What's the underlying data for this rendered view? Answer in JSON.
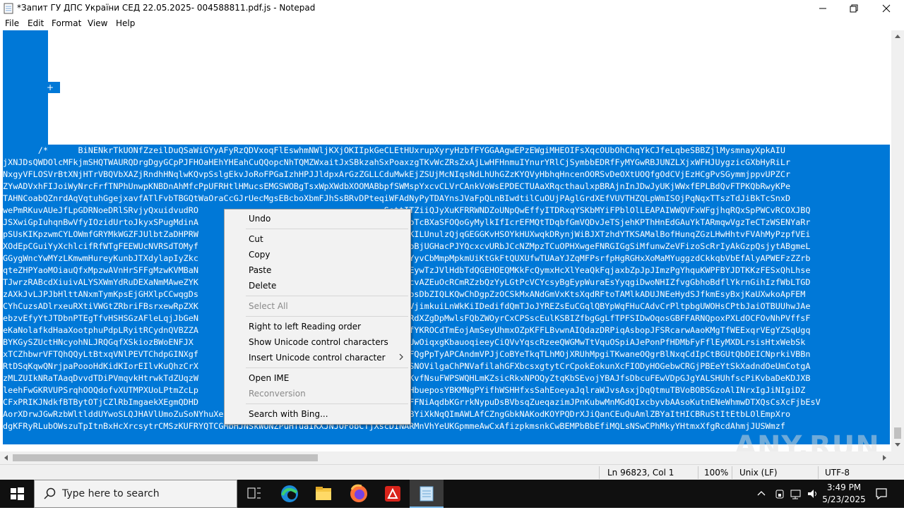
{
  "window": {
    "title": "*Запит ГУ ДПС України СЕД 22.05.2025- 004588811.pdf.js - Notepad",
    "controls": [
      "minimize",
      "maximize",
      "close"
    ]
  },
  "menu": {
    "items": [
      "File",
      "Edit",
      "Format",
      "View",
      "Help"
    ]
  },
  "editor": {
    "plus_glyph": "+",
    "lines": [
      "       /*      BiNENkrTkUONfZzeilDuQSaWiGYyAFyRzQDVxoqFlEswhmNWljKXjOKIIpkGeCLEtHUxrupXyryHzbfFYGGAAgwEPzEWgiMHEOIFsXqcOUbOhChqYkCJfeLqbeSBBZjlMysmnayXpkAIU",
      "jXNJDsQWDOlcMFkjmSHQTWAURQDrgDgyGCpPJFHOaHEhYHEahCuQQopcNhTQMZWxaitJxSBkzahSxPoaxzgTKvWcZRsZxAjLwHFHnmuIYnurYRlCjSymbbEDRfFyMYGwRBJUNZLXjxWFHJUygzicGXbHyRiLr",
      "NxgyVFLOSVrBtXNjHTrVBQVbXAZjRndhHNqlwKQvpSslgEkvJoRoFPGaIzhHPJJldpxArGzZGLLCduMwkEjZSUjMcNIqsNdLhUhGZzKYQVyHbhqHncenOORSvDeOXtUOQfgOdCVjEzHCgPvSGymmjppvUPZCr",
      "ZYwADVxhFIJoiWyNrcFrfTNPhUnwpKNBDnAhMfcPpUFRHtlHMucsEMGSWOBgTsxWpXWdbXOOMABbpfSWMspYxcvCLVrCAnkVoWsEPDECTUAaXRqcthaulxpBRAjnInJDwJyUKjWWxfEPLBdQvFTPKQbRwyKPe",
      "TAHNCoabQZnrdAqVqtuhGgejxavfATlFvbTBGQtWaOraCcGJrUecMgsEBcboXbmFJhSsBRvDPteqiWFAdNyPyTDAYnsJVaFpQLnBIwdtilCuOUjPAglGrdXEfVUVTHZQLpWmISOjPqNqxTTszTdJiBkTcSnxD",
      "wePmRKuvAUeJfLpGDRNoeDRlSRvjyQxuidvudRO                                     SsttITZiiQJyXuKFRRWNDZoUNpQwEffyITDRxqYSKbMYiFPblOlLEAPAIWWQVFxWFgjhqRQxSpPWCvRCOXJBQ",
      "JSXwiGpIuhqnBwVfyIOzidUrtoJkyxSPugMdinA                                     vvmOWbTcBXaSFOQoGyMylkIfIcrEFMQtTDqbfGmVQDvJeTSjehKPThHnEdGAuYkTARmqwVgzTeCTzWSENYaRr",
      "pSUsKIKpzwmCYLOWmfGRYMkWGZFJUlbtZaDHPRW                                     CiTBgKILUnulzQjqGEGGKvHSOYkHUXwqkDRynjWiBJXTzhdYTKSAMalBofHunqZGzLHwHhtvFVAhMyPzpfVEi",
      "XOdEpCGuiYyXchlcifRfWTgFEEWUcNVRSdTOMyf                                     OIqUvbBjUGHacPJYQcxcvURbJCcNZMpzTCuOPHXwgeFNRGIGgSiMfunwZeVFizoScRrIyAkGzpQsjytABgmeL",
      "GGygWncYwMYzLKmwmHureyKunbJTXdylapIyZkc                                     eUCURYyvCbMmpMpkmUiKtGkFtQUXUfwTUAaYJZqMFPsrfpHgRGHxXoMaMYuggzdCkkqbVbEfAlyAPWEFzZZrb",
      "qteZHPYaoMOiauQfxMpzwAVnHrSFFgMzwKVMBaN                                     zTDBtEywTzJVlHdbTdQGEHOEQMKkFcQymxHcXlYeaQkFqjaxbZpJpJImzPgYhquKWPFBYJDTKKzFESxQhLhse",
      "TJwrzRABcdXiuivALYSXWmYdRuDEXaNmMAweZYK                                     jiMUFcvAZEuOcRCmRZzbQzYyLGtPcVCYcsyBgEypWuraEsYyqgiDwoNHIZfvgGbhoBdflYkrnGihIzfWbLTGD",
      "zAXkJvLJPJbHlttANxmTymKpsEjGHXlpCCwqgDs                                     DySWqpsDbZIQLKQwChDgpZzOCSkMxANdGmVxKtsXqdRFtoTAMlkADUJNEeHydSJfkmEsyBxjKaUXwkoApFEM",
      "CYhCuzsADlrxeuRXtiVWGtZRbriFBsrxewRpZXK                                     zlKNRVjimkuiLnWkKiIDedifdQmTJoJYREZsEuCGqlQBYpWqFHuCAdvCrPltpbgUWOHsCPtbJaiOTBUUhwJAe",
      "ebzvEfyYtJTDbnPTEgTfvHSHSGzAFleLqjJbGeN                                     wtovoRdXZgDpMwlsFQbZWOyrCxCPSscEulKSBIZfbgGgLfTPFSIDwOqosGBFFARNQpoxPXLdOCFOvNhPVffsF",
      "eKaNolafkdHaaXootphuPdpLRyitRCydnQVBZZA                                     UXDTofYKROCdTmEojAmSeyUhmxOZpKFFLBvwnAIQdazDRPiqAsbopJFSRcarwAaoKMgTfWEExqrVEgYZSqUgq",
      "BYKGySZUctHNcyohNLJRQGqfXSkiozBWoENFJX                                     tXEiRJUwOiqxgKbauoqieeyCiQVvYqscRzeeQWGMwTtVquOSpiAJePonPfHDMbFyFflEyMXDLrsisHtxWebSk",
      "xTCZhbwrVFTQhQQyLtBtxqVNlPEVTChdpGINXgf                                     uusnYFQgPpTyAPCAndmVPJjCoBYeTkqTLhMOjXRUhMpgiTKwaneOQgrBlNxqCdIpCtBGUtQbDEICNprkiVBBn",
      "RtDSqKqwQNrjpaPoooHdKidKIorEIlvKuQhzCrX                                     XmRiHSNOVilgaChPNVafilahGFXbcsxgtytCrCpokEokunXcFIODyHOGebwCRGjPBEeYtSkXadndOeUmCotgA",
      "zMLZUIkNRaTAaqDvvdTDiPVmqvkHtrwkTdZUqzW                                     BcUTwKvfNsuFWPSWQHLmKZsicRkxNPOQyZtqKbSEvojYBAJfsDbcuFEwVDpGJgYALSHUhfscPiKvbaDeKDJXB",
      "leehFwGKRVUPSrqhOOQdofvXUTMPXUoLPtmZcLp                                     lZwIrHbueposYBKMNgPYifhWSHHfxsSahEoeyaJqlraWJvsAsxjDqQtmuTBVoBOBSGzoAlINrxIgJiNIgiDZ",
      "CFxPRIKJNdkfBTBytOTjCZlRbImgaekXEgmQDHD                                     iSPaEFFNiAqdbKGrrkNypuDsBVbsqZueqazimJPnKubwMnMGdQIxcbyvbAAsoKutnENeWhmwDTXQsCsXcFjbEsV",
      "AorXDrwJGwRzbWltlddUYwoSLQJHAVlUmoZuSoNYhuXeUxlTOvhMbfnJjAfQUfBudXDlyFGtUcYVhEhlYBYiXkNqQImAWLAfCZngGbkNAKodKOYPQDrXJiQanCEuQuAmlZBYaItHICBRuStItEtbLOlEmpXro",
      "dgKFRyRLubOWszuTpItnBxHcXrcsytrCMSzKUFRYQTCGMbHJNSkWUNZPuHTuaIKXJNJOFobCTjXscDINARMnVhYeUKGpmmeAwCxAfizpkmsnkCwBEMPbBbEfiMQLsNSwCPhMkyYHtmxXfgRcdAhmjJUSWmzf"
    ]
  },
  "context_menu": {
    "items": [
      {
        "label": "Undo",
        "enabled": true
      },
      {
        "label": "Cut",
        "enabled": true
      },
      {
        "label": "Copy",
        "enabled": true
      },
      {
        "label": "Paste",
        "enabled": true
      },
      {
        "label": "Delete",
        "enabled": true
      },
      {
        "label": "Select All",
        "enabled": false
      },
      {
        "label": "Right to left Reading order",
        "enabled": true
      },
      {
        "label": "Show Unicode control characters",
        "enabled": true
      },
      {
        "label": "Insert Unicode control character",
        "enabled": true,
        "submenu": true
      },
      {
        "label": "Open IME",
        "enabled": true
      },
      {
        "label": "Reconversion",
        "enabled": false
      },
      {
        "label": "Search with Bing...",
        "enabled": true
      }
    ]
  },
  "statusbar": {
    "position": "Ln 96823, Col 1",
    "zoom": "100%",
    "line_ending": "Unix (LF)",
    "encoding": "UTF-8"
  },
  "taskbar": {
    "search_placeholder": "Type here to search",
    "pinned": [
      "task-view-icon",
      "edge-icon",
      "file-explorer-icon",
      "firefox-icon",
      "acrobat-icon",
      "notepad-icon"
    ],
    "time": "3:49 PM",
    "date": "5/23/2025"
  },
  "watermark": "ANY.RUN",
  "colors": {
    "selection": "#0078d7",
    "taskbar": "#101010"
  }
}
